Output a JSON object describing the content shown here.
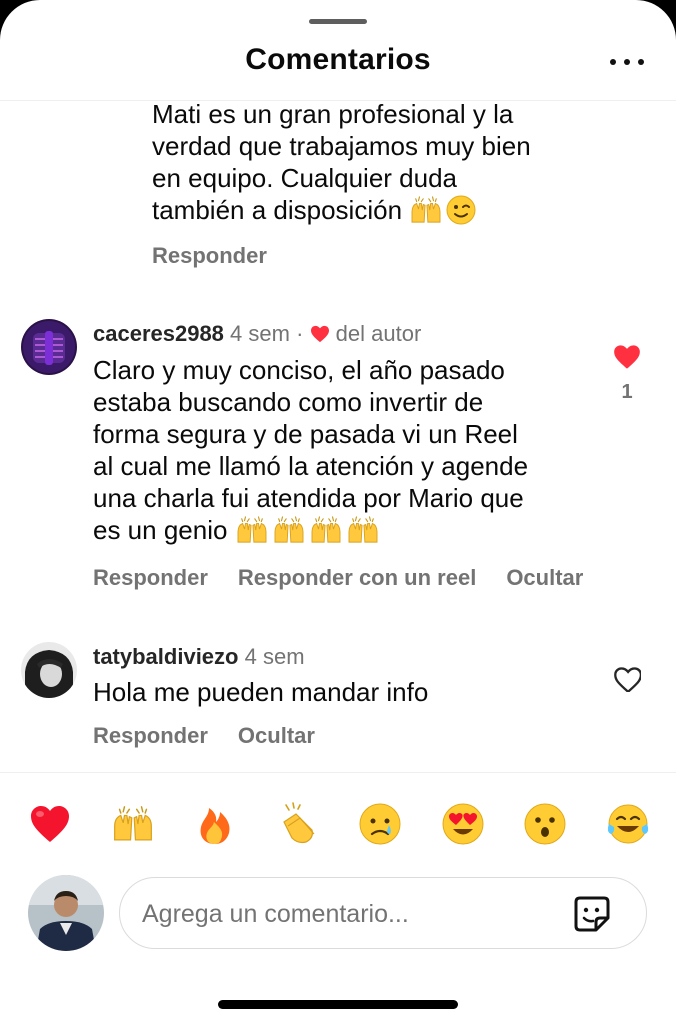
{
  "header": {
    "title": "Comentarios",
    "menu_icon": "more-horizontal-icon"
  },
  "comments": [
    {
      "lines": [
        "Mati es un gran profesional y la",
        "verdad que trabajamos muy bien",
        "en equipo. Cualquier duda",
        "también a disposición"
      ],
      "emojis": [
        "raising-hands-emoji",
        "winking-face-emoji"
      ],
      "actions": [
        "Responder"
      ]
    },
    {
      "username": "caceres2988",
      "time": "4 sem",
      "separator": "·",
      "author_like_label": "del autor",
      "lines": [
        "Claro y muy conciso, el año pasado",
        "estaba buscando como invertir de",
        "forma segura y de pasada vi un Reel",
        "al cual me llamó la atención y agende",
        "una charla fui atendida por Mario que",
        "es un genio"
      ],
      "emojis": [
        "raising-hands-emoji",
        "raising-hands-emoji",
        "raising-hands-emoji",
        "raising-hands-emoji"
      ],
      "liked": true,
      "like_count": "1",
      "actions": [
        "Responder",
        "Responder con un reel",
        "Ocultar"
      ]
    },
    {
      "username": "tatybaldiviezo",
      "time": "4 sem",
      "lines": [
        "Hola me pueden mandar info"
      ],
      "liked": false,
      "actions": [
        "Responder",
        "Ocultar"
      ]
    }
  ],
  "reactions": [
    "red-heart",
    "raising-hands",
    "fire",
    "clapping-hands",
    "crying-face",
    "heart-eyes",
    "surprised-face",
    "tears-of-joy"
  ],
  "composer": {
    "placeholder": "Agrega un comentario...",
    "sticker_icon": "sticker-icon"
  },
  "colors": {
    "like_red": "#ff3040",
    "secondary_text": "#737373",
    "primary_text": "#0a0a0a"
  }
}
